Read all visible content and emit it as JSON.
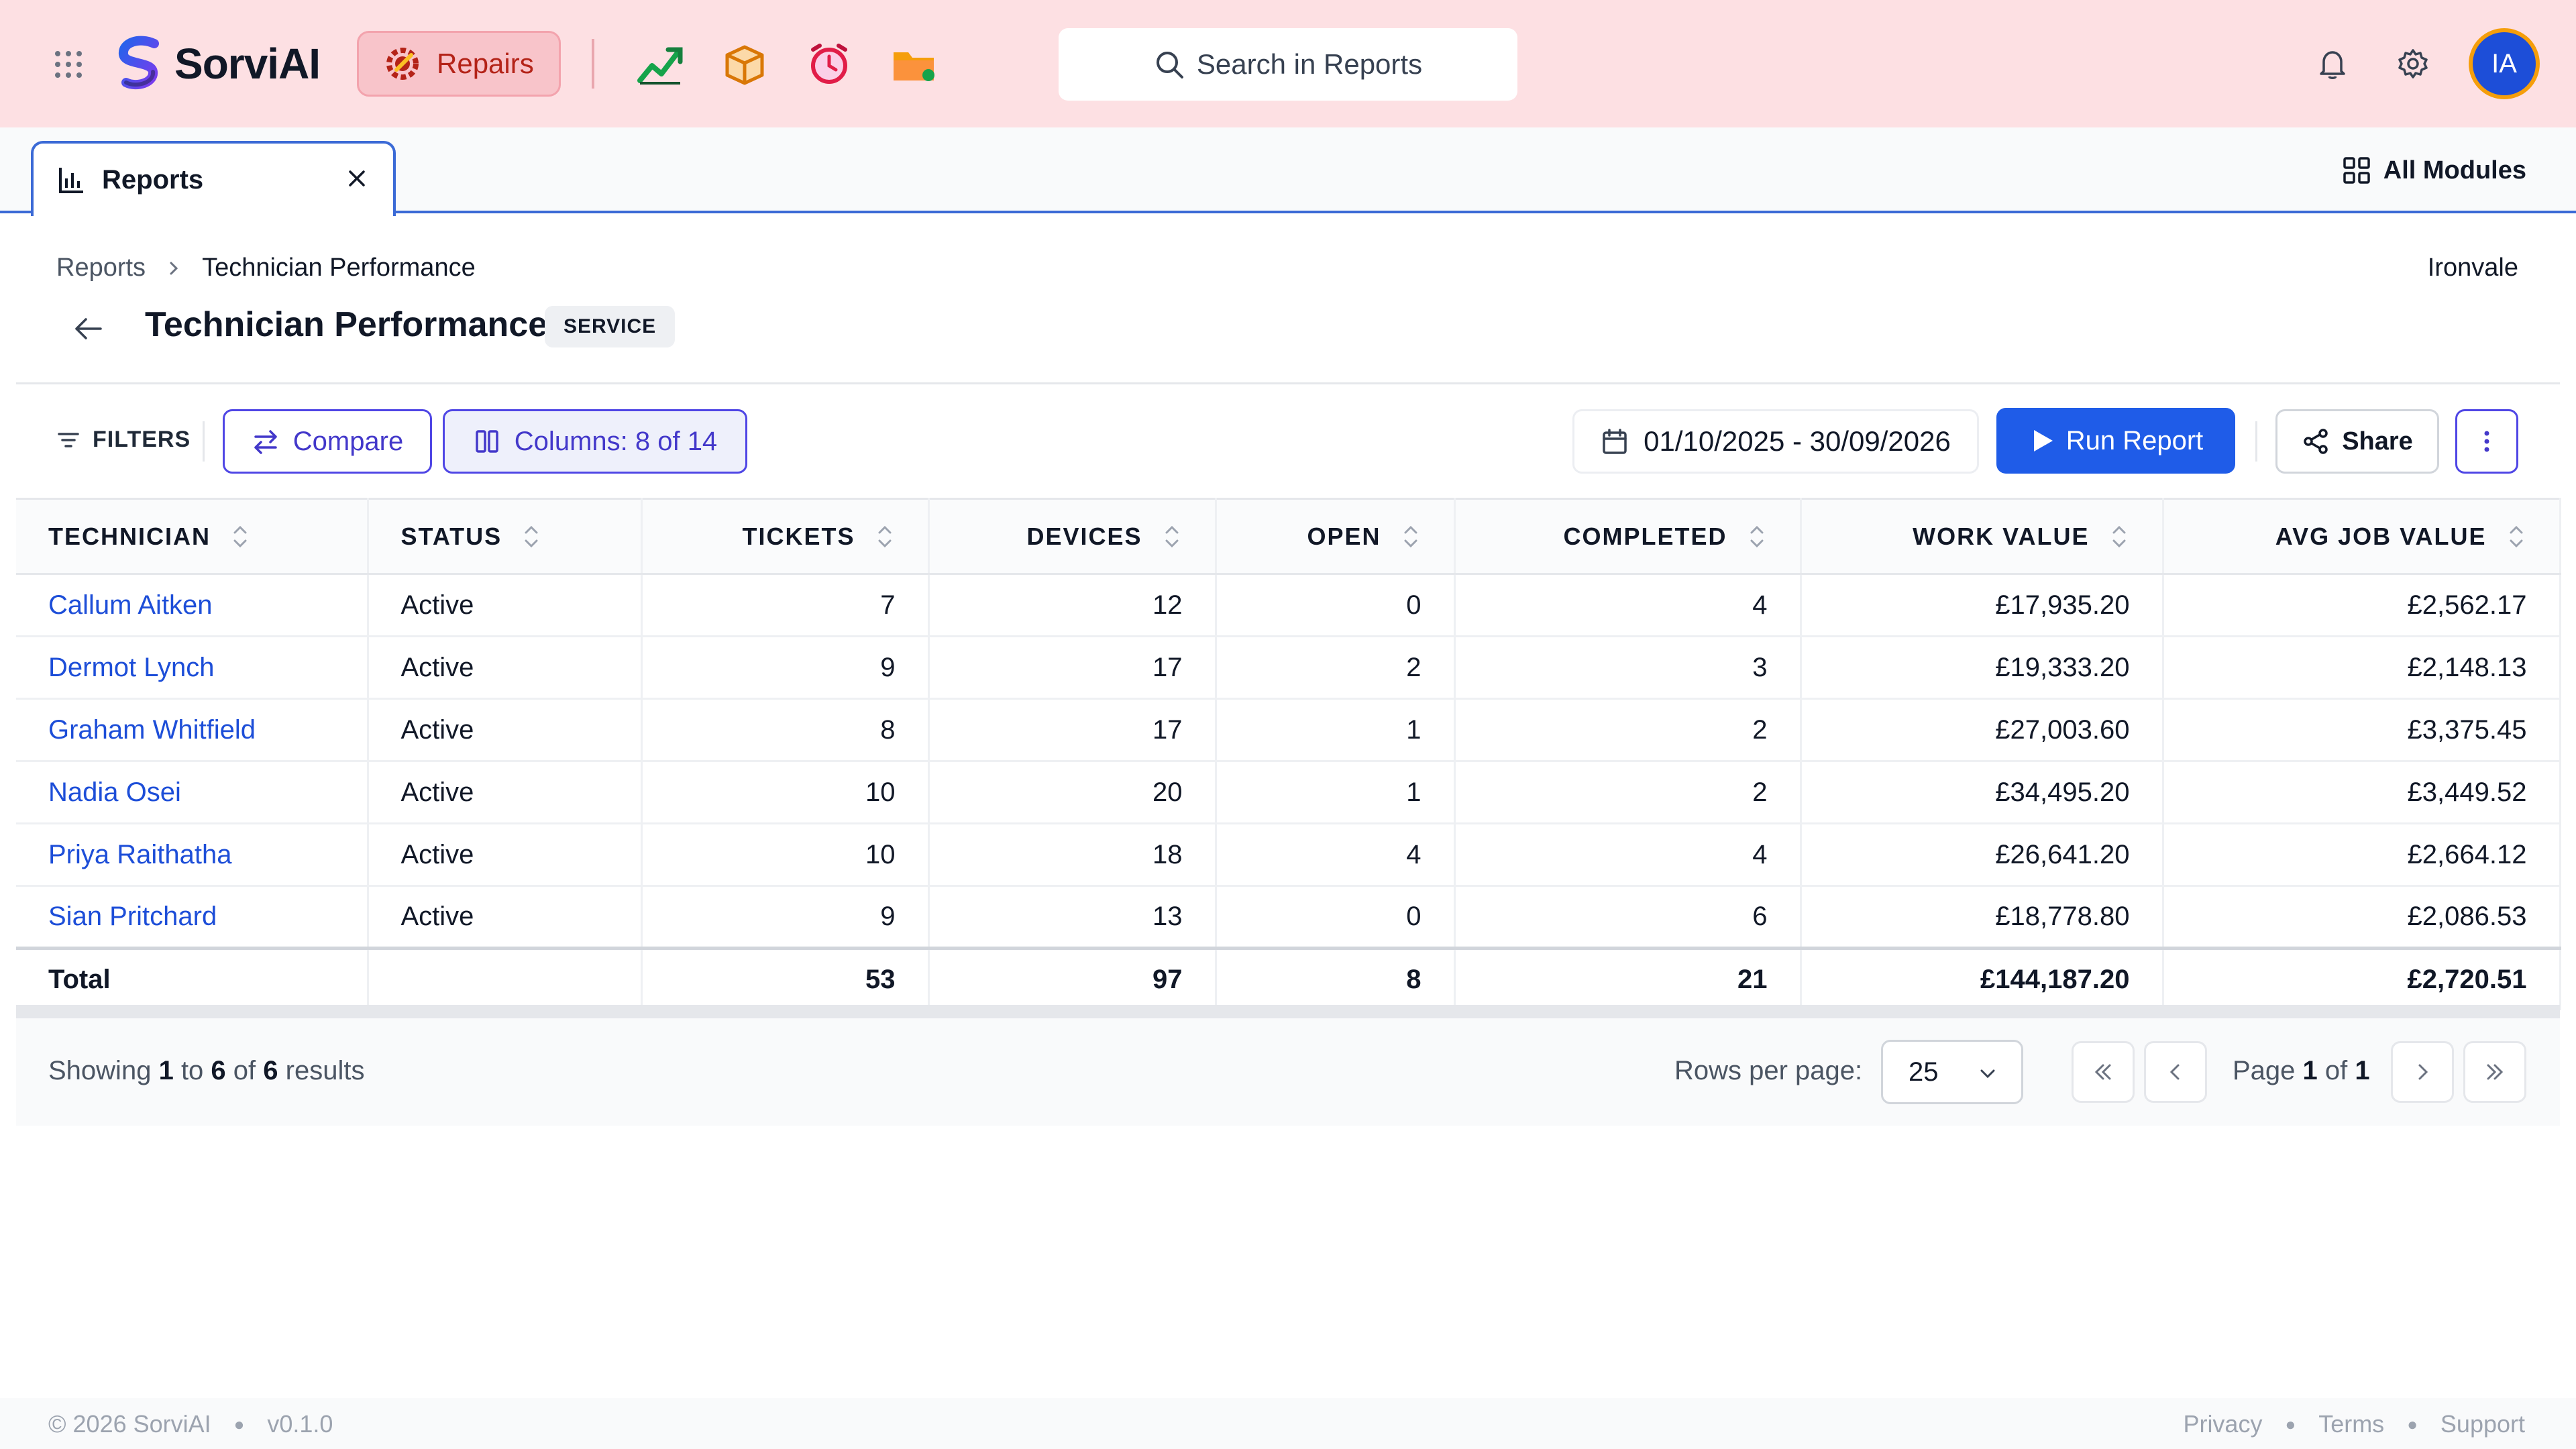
{
  "header": {
    "brand": "SorviAI",
    "active_module": "Repairs",
    "search_placeholder": "Search in Reports",
    "avatar_initials": "IA",
    "colors": {
      "topbar": "#fde0e3",
      "accent": "#1f5ce8",
      "module_text": "#b42318"
    },
    "app_icons": [
      "growth-chart-icon",
      "box-icon",
      "alarm-icon",
      "folder-icon"
    ]
  },
  "tabs": {
    "active": "Reports",
    "all_modules": "All Modules"
  },
  "breadcrumb": {
    "root": "Reports",
    "current": "Technician Performance"
  },
  "org": "Ironvale",
  "page": {
    "title": "Technician Performance",
    "badge": "SERVICE"
  },
  "toolbar": {
    "filters": "FILTERS",
    "compare": "Compare",
    "columns": "Columns: 8 of 14",
    "date_range": "01/10/2025 - 30/09/2026",
    "run": "Run Report",
    "share": "Share"
  },
  "table": {
    "columns": [
      "TECHNICIAN",
      "STATUS",
      "TICKETS",
      "DEVICES",
      "OPEN",
      "COMPLETED",
      "WORK VALUE",
      "AVG JOB VALUE"
    ],
    "rows": [
      {
        "technician": "Callum Aitken",
        "status": "Active",
        "tickets": "7",
        "devices": "12",
        "open": "0",
        "completed": "4",
        "work_value": "£17,935.20",
        "avg_job_value": "£2,562.17"
      },
      {
        "technician": "Dermot Lynch",
        "status": "Active",
        "tickets": "9",
        "devices": "17",
        "open": "2",
        "completed": "3",
        "work_value": "£19,333.20",
        "avg_job_value": "£2,148.13"
      },
      {
        "technician": "Graham Whitfield",
        "status": "Active",
        "tickets": "8",
        "devices": "17",
        "open": "1",
        "completed": "2",
        "work_value": "£27,003.60",
        "avg_job_value": "£3,375.45"
      },
      {
        "technician": "Nadia Osei",
        "status": "Active",
        "tickets": "10",
        "devices": "20",
        "open": "1",
        "completed": "2",
        "work_value": "£34,495.20",
        "avg_job_value": "£3,449.52"
      },
      {
        "technician": "Priya Raithatha",
        "status": "Active",
        "tickets": "10",
        "devices": "18",
        "open": "4",
        "completed": "4",
        "work_value": "£26,641.20",
        "avg_job_value": "£2,664.12"
      },
      {
        "technician": "Sian Pritchard",
        "status": "Active",
        "tickets": "9",
        "devices": "13",
        "open": "0",
        "completed": "6",
        "work_value": "£18,778.80",
        "avg_job_value": "£2,086.53"
      }
    ],
    "total": {
      "label": "Total",
      "tickets": "53",
      "devices": "97",
      "open": "8",
      "completed": "21",
      "work_value": "£144,187.20",
      "avg_job_value": "£2,720.51"
    }
  },
  "pagination": {
    "showing_prefix": "Showing",
    "from": "1",
    "to_word": "to",
    "to": "6",
    "of_word": "of",
    "total": "6",
    "results_word": "results",
    "rows_per_page_label": "Rows per page:",
    "rows_per_page": "25",
    "page_word": "Page",
    "page": "1",
    "page_of": "of",
    "pages": "1"
  },
  "footer": {
    "copyright": "© 2026 SorviAI",
    "version": "v0.1.0",
    "links": [
      "Privacy",
      "Terms",
      "Support"
    ]
  }
}
